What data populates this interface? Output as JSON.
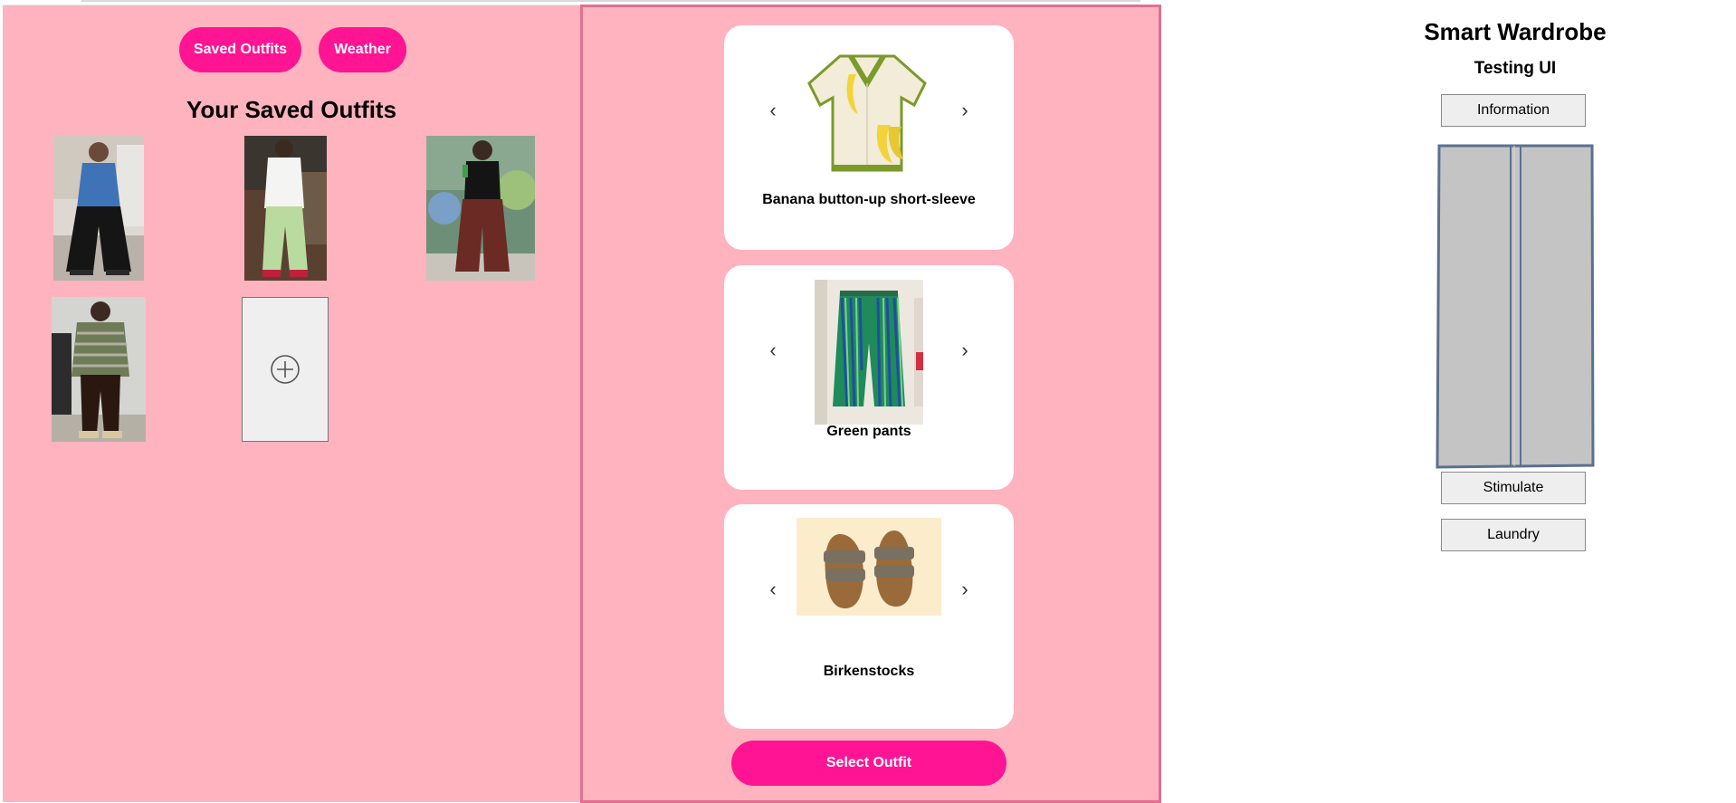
{
  "nav": {
    "saved_outfits_label": "Saved Outfits",
    "weather_label": "Weather"
  },
  "saved": {
    "title": "Your Saved Outfits",
    "outfits": [
      {
        "name": "Denim jacket with black wide-leg pants"
      },
      {
        "name": "White shirt with light green pants"
      },
      {
        "name": "Black top with maroon wide-leg pants"
      },
      {
        "name": "Striped sweater with brown pants"
      }
    ],
    "add_icon": "plus-circle-icon"
  },
  "builder": {
    "items": [
      {
        "label": "Banana button-up short-sleeve",
        "category": "top"
      },
      {
        "label": "Green pants",
        "category": "bottom"
      },
      {
        "label": "Birkenstocks",
        "category": "shoes"
      }
    ],
    "prev_glyph": "‹",
    "next_glyph": "›",
    "select_label": "Select Outfit"
  },
  "wardrobe": {
    "title": "Smart Wardrobe",
    "subtitle": "Testing UI",
    "information_label": "Information",
    "stimulate_label": "Stimulate",
    "laundry_label": "Laundry"
  },
  "colors": {
    "panel_pink": "#ffb3bf",
    "accent_pink": "#ff1493",
    "mid_border": "#e07090",
    "wardrobe_gray": "#c4c4c4",
    "wardrobe_outline": "#5a7090"
  }
}
